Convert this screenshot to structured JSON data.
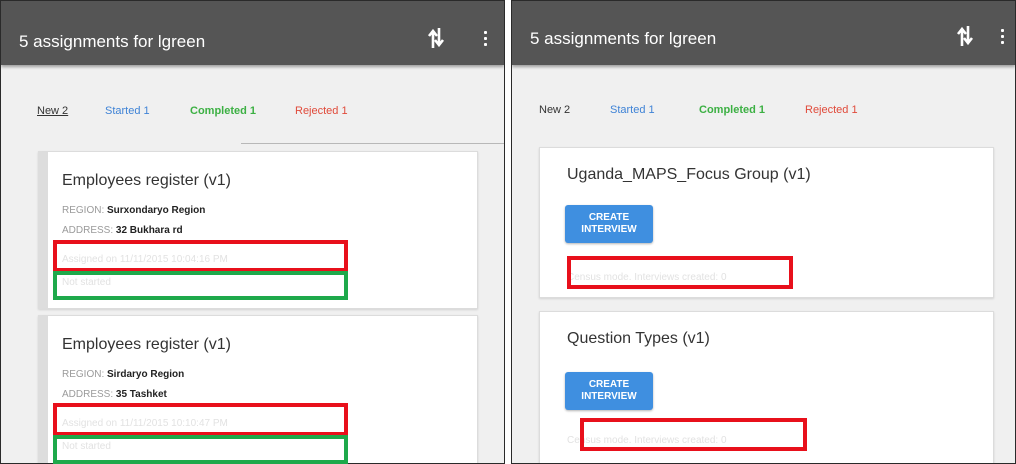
{
  "left_panel": {
    "title": "5 assignments for lgreen",
    "tabs": {
      "new": "New 2",
      "started": "Started 1",
      "completed": "Completed 1",
      "rejected": "Rejected 1"
    },
    "cards": [
      {
        "title": "Employees register (v1)",
        "region_label": "REGION:",
        "region_value": "Surxondaryo Region",
        "address_label": "ADDRESS:",
        "address_value": "32 Bukhara rd",
        "assigned": "Assigned on 11/11/2015 10:04:16 PM",
        "status": "Not started"
      },
      {
        "title": "Employees register (v1)",
        "region_label": "REGION:",
        "region_value": "Sirdaryo Region",
        "address_label": "ADDRESS:",
        "address_value": "35 Tashket",
        "assigned": "Assigned on 11/11/2015 10:10:47 PM",
        "status": "Not started"
      }
    ]
  },
  "right_panel": {
    "title": "5 assignments for lgreen",
    "tabs": {
      "new": "New 2",
      "started": "Started 1",
      "completed": "Completed 1",
      "rejected": "Rejected 1"
    },
    "cards": [
      {
        "title": "Uganda_MAPS_Focus Group (v1)",
        "button": "CREATE INTERVIEW",
        "census": "Census mode. Interviews created: 0"
      },
      {
        "title": "Question Types (v1)",
        "button": "CREATE INTERVIEW",
        "census": "Census mode. Interviews created: 0"
      }
    ]
  },
  "colors": {
    "toolbar": "#555555",
    "tab_started": "#3f83d6",
    "tab_completed": "#3cb043",
    "tab_rejected": "#e04a3a",
    "button": "#3f8fe0",
    "highlight_red": "#e8101b",
    "highlight_green": "#1ea94b"
  },
  "icons": [
    "sync-icon",
    "overflow-menu-icon"
  ]
}
